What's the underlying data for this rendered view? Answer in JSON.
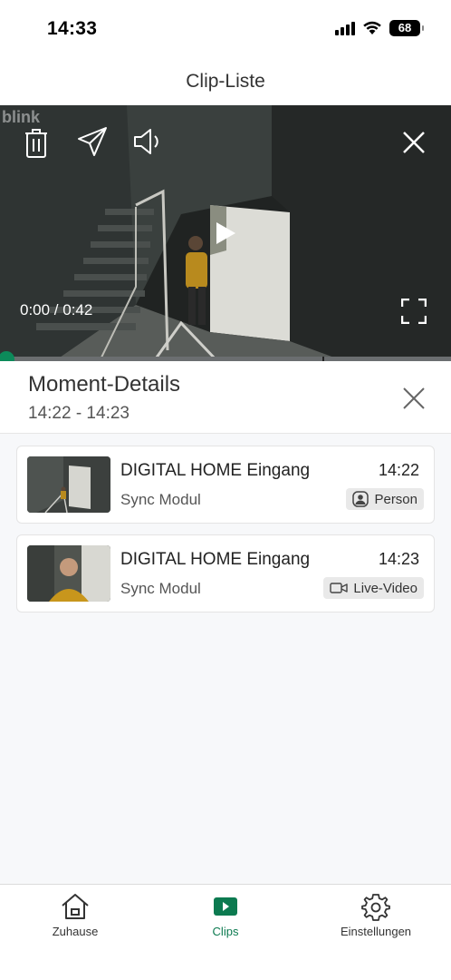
{
  "status_bar": {
    "time": "14:33",
    "battery": "68"
  },
  "header": {
    "title": "Clip-Liste"
  },
  "player": {
    "watermark": "blink",
    "time": "0:00 / 0:42",
    "progress": 0.0,
    "accent_color": "#0c8a5a",
    "icons": [
      "trash-icon",
      "send-icon",
      "speaker-icon",
      "close-icon",
      "play-icon",
      "fullscreen-icon"
    ]
  },
  "moment": {
    "title": "Moment-Details",
    "range": "14:22 - 14:23"
  },
  "clips": [
    {
      "name": "DIGITAL HOME Eingang",
      "time": "14:22",
      "source": "Sync Modul",
      "badge": "Person",
      "badge_icon": "person-icon"
    },
    {
      "name": "DIGITAL HOME Eingang",
      "time": "14:23",
      "source": "Sync Modul",
      "badge": "Live-Video",
      "badge_icon": "video-camera-icon"
    }
  ],
  "tabs": [
    {
      "label": "Zuhause",
      "icon": "home-icon",
      "active": false
    },
    {
      "label": "Clips",
      "icon": "clips-play-icon",
      "active": true
    },
    {
      "label": "Einstellungen",
      "icon": "gear-icon",
      "active": false
    }
  ],
  "colors": {
    "accent": "#0c7a50",
    "background": "#f7f8fa"
  }
}
